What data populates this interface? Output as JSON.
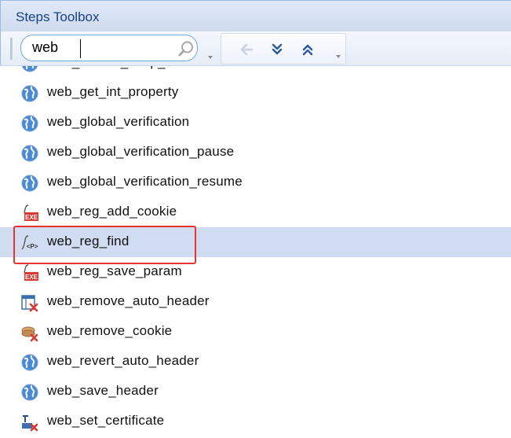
{
  "panel": {
    "title": "Steps Toolbox"
  },
  "search": {
    "value": "web",
    "placeholder": ""
  },
  "toolbar": {
    "buttons": [
      {
        "name": "back-arrow-icon"
      },
      {
        "name": "expand-all-icon"
      },
      {
        "name": "collapse-all-icon"
      }
    ]
  },
  "steps": [
    {
      "label": "web_enable_keep_alive",
      "icon": "globe-icon"
    },
    {
      "label": "web_get_int_property",
      "icon": "globe-icon"
    },
    {
      "label": "web_global_verification",
      "icon": "globe-icon"
    },
    {
      "label": "web_global_verification_pause",
      "icon": "globe-icon"
    },
    {
      "label": "web_global_verification_resume",
      "icon": "globe-icon"
    },
    {
      "label": "web_reg_add_cookie",
      "icon": "exe-function-icon"
    },
    {
      "label": "web_reg_find",
      "icon": "parameter-function-icon",
      "selected": true
    },
    {
      "label": "web_reg_save_param",
      "icon": "exe-function-icon"
    },
    {
      "label": "web_remove_auto_header",
      "icon": "remove-header-icon"
    },
    {
      "label": "web_remove_cookie",
      "icon": "remove-cookie-icon"
    },
    {
      "label": "web_revert_auto_header",
      "icon": "globe-icon"
    },
    {
      "label": "web_save_header",
      "icon": "globe-icon"
    },
    {
      "label": "web_set_certificate",
      "icon": "certificate-icon"
    }
  ],
  "colors": {
    "selection": "#cfdcf1",
    "highlight_border": "#e8342e",
    "title_text": "#15428b"
  }
}
